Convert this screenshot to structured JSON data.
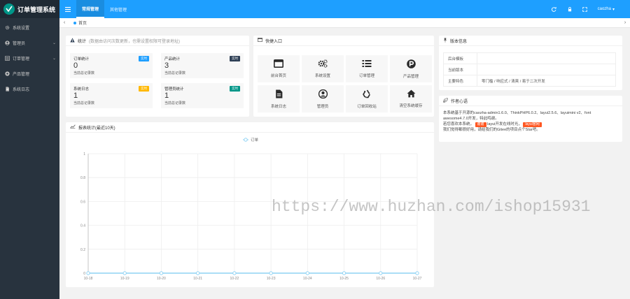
{
  "app": {
    "title": "订单管理系统"
  },
  "sidebar": {
    "items": [
      {
        "label": "系统设置",
        "icon": "gears-icon",
        "chevron": false
      },
      {
        "label": "管理员",
        "icon": "user-icon",
        "chevron": true
      },
      {
        "label": "订单管理",
        "icon": "list-icon",
        "chevron": true
      },
      {
        "label": "产品管理",
        "icon": "box-icon",
        "chevron": false
      },
      {
        "label": "系统日志",
        "icon": "doc-icon",
        "chevron": false
      }
    ]
  },
  "header": {
    "tabs": [
      {
        "label": "常规管理",
        "active": true
      },
      {
        "label": "其他管理",
        "active": false
      }
    ],
    "user": "caozha"
  },
  "tabbar": {
    "home_label": "首页"
  },
  "stats": {
    "title": "统计",
    "subtitle": "(数据由访问次数更新，也需设置权限可登录地址)",
    "cards": [
      {
        "title": "订单统计",
        "badge": "实时",
        "badge_color": "#1e9fff",
        "value": "0",
        "note": "当前总记录数"
      },
      {
        "title": "产品统计",
        "badge": "实时",
        "badge_color": "#2f4056",
        "value": "3",
        "note": "当前总记录数"
      },
      {
        "title": "系统日志",
        "badge": "实时",
        "badge_color": "#ffb800",
        "value": "1",
        "note": "当前总记录数"
      },
      {
        "title": "管理员统计",
        "badge": "实时",
        "badge_color": "#009688",
        "value": "1",
        "note": "当前总记录数"
      }
    ]
  },
  "shortcuts": {
    "title": "快捷入口",
    "items": [
      {
        "label": "前台首页",
        "icon": "window-icon"
      },
      {
        "label": "系统设置",
        "icon": "gears-icon"
      },
      {
        "label": "订单管理",
        "icon": "list-icon"
      },
      {
        "label": "产品管理",
        "icon": "product-p-icon"
      },
      {
        "label": "系统日志",
        "icon": "doc-icon"
      },
      {
        "label": "管理员",
        "icon": "user-circle-icon"
      },
      {
        "label": "订单回收站",
        "icon": "recycle-icon"
      },
      {
        "label": "清空系统缓存",
        "icon": "home-icon"
      }
    ]
  },
  "version": {
    "title": "版本信息",
    "rows": [
      {
        "key": "后台模板",
        "value": ""
      },
      {
        "key": "当前版本",
        "value": ""
      },
      {
        "key": "主要特色",
        "value": "零门槛 / 响应式 / 清爽 / 易于二次开发"
      }
    ]
  },
  "author": {
    "title": "作者心语",
    "line1": "本系统基于开源的caozha-admin1.6.0、ThinkPHP6.0.2、layui2.5.6、layuimini v2、font",
    "line2": "awesome4.7.0开发，特此鸣谢。",
    "line3_prefix": "若您喜欢本系统，",
    "tag1": "谢谢",
    "line3_middle": "layui开发在线时光，",
    "tag2": "layui官网",
    "line4": "我们觉得都很好用，请给我们的Gitee的项目点个Star吧。"
  },
  "chart_section": {
    "title": "报表统计(最近10天)"
  },
  "chart_data": {
    "type": "line",
    "legend": "订单",
    "categories": [
      "10-18",
      "10-19",
      "10-20",
      "10-21",
      "10-22",
      "10-23",
      "10-24",
      "10-25",
      "10-26",
      "10-27"
    ],
    "series": [
      {
        "name": "订单",
        "values": [
          0,
          0,
          0,
          0,
          0,
          0,
          0,
          0,
          0,
          0
        ]
      }
    ],
    "ylim": [
      0,
      1
    ],
    "yticks": [
      "0",
      "0.2",
      "0.4",
      "0.6",
      "0.8",
      "1"
    ],
    "grid": true,
    "line_color": "#8fd3f4"
  },
  "watermark": "https://www.huzhan.com/ishop15931"
}
